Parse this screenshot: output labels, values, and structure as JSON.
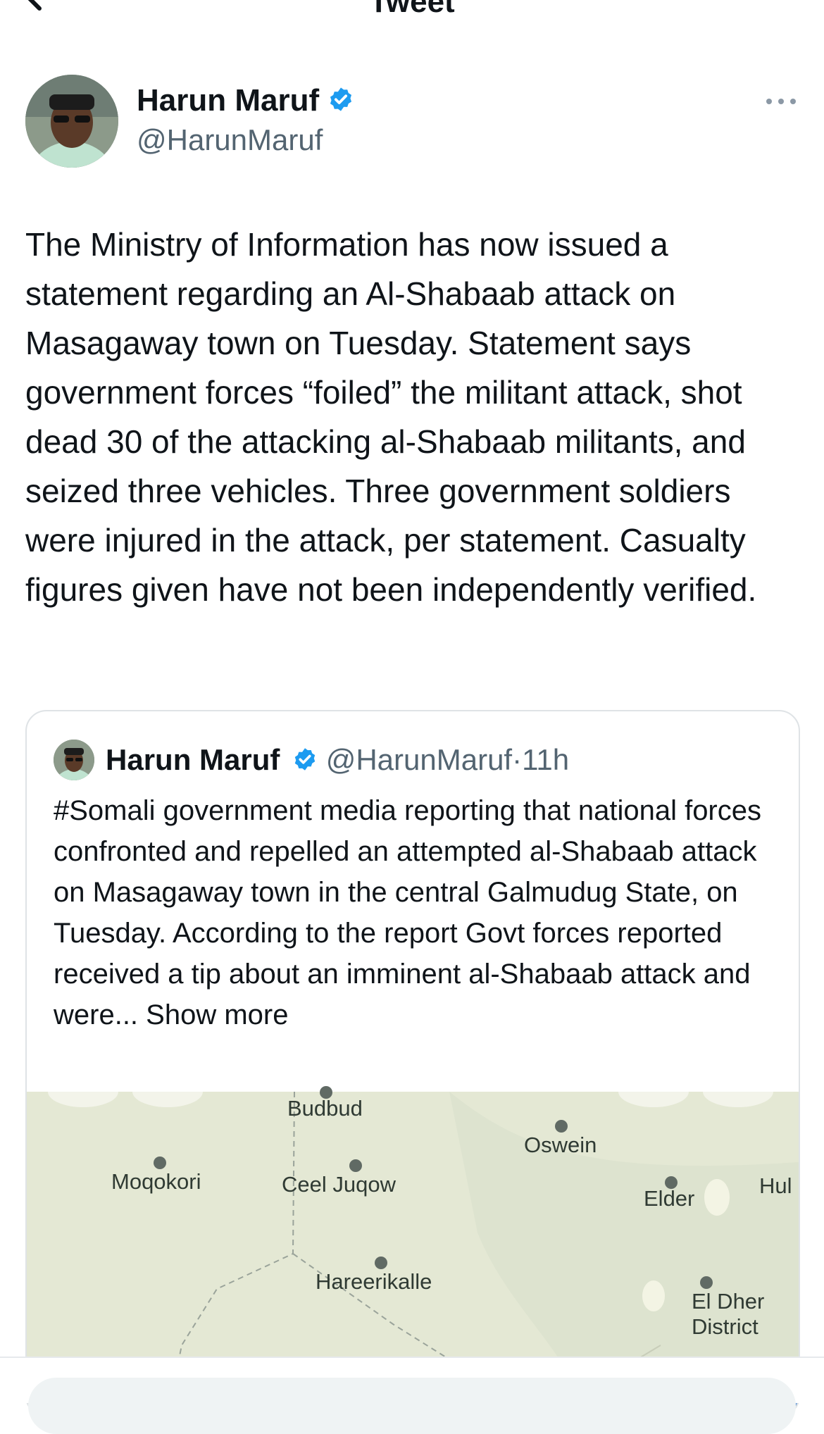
{
  "header": {
    "title": "Tweet",
    "back_icon": "arrow-left-icon"
  },
  "tweet": {
    "author_name": "Harun Maruf",
    "author_handle": "@HarunMaruf",
    "verified_icon": "verified-badge-icon",
    "more_icon": "more-horizontal-icon",
    "text": "The Ministry of Information has now issued a statement regarding an Al-Shabaab attack on Masagaway town on Tuesday. Statement says government forces “foiled” the militant attack, shot dead 30 of the attacking al-Shabaab militants, and seized three vehicles. Three government soldiers were injured in the attack, per statement. Casualty figures given have not been independently verified."
  },
  "quoted_tweet": {
    "author_name": "Harun Maruf",
    "author_handle": "@HarunMaruf",
    "time": "11h",
    "separator": "·",
    "text": "#Somali government media reporting that national forces confronted and repelled an attempted al-Shabaab attack on Masagaway town in the central Galmudug State, on Tuesday. According to the report Govt forces reported received a tip about an imminent al-Shabaab attack and were...",
    "show_more": "Show more"
  },
  "map": {
    "places": [
      "Budbud",
      "Oswein",
      "Moqokori",
      "Ceel Juqow",
      "Elder",
      "Hul",
      "Hareerikalle",
      "El Dher District"
    ]
  },
  "colors": {
    "text": "#0f1419",
    "secondary": "#536471",
    "verified": "#1d9bf0",
    "map_land": "#e6e9d6"
  }
}
